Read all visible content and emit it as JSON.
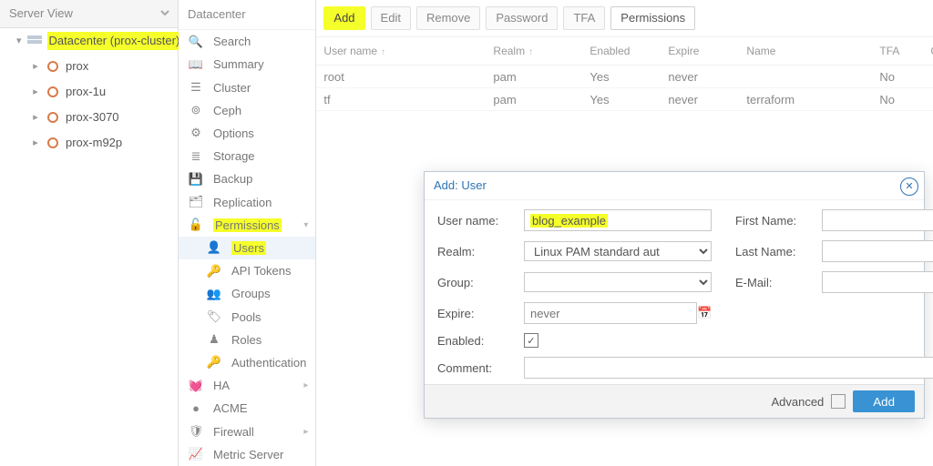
{
  "tree": {
    "header": "Server View",
    "root": "Datacenter (prox-cluster)",
    "nodes": [
      "prox",
      "prox-1u",
      "prox-3070",
      "prox-m92p"
    ]
  },
  "breadcrumb": "Datacenter",
  "menu": {
    "search": "Search",
    "summary": "Summary",
    "cluster": "Cluster",
    "ceph": "Ceph",
    "options": "Options",
    "storage": "Storage",
    "backup": "Backup",
    "replication": "Replication",
    "permissions": "Permissions",
    "users": "Users",
    "apitokens": "API Tokens",
    "groups": "Groups",
    "pools": "Pools",
    "roles": "Roles",
    "auth": "Authentication",
    "ha": "HA",
    "acme": "ACME",
    "firewall": "Firewall",
    "metric": "Metric Server"
  },
  "toolbar": {
    "add": "Add",
    "edit": "Edit",
    "remove": "Remove",
    "password": "Password",
    "tfa": "TFA",
    "permissions": "Permissions"
  },
  "grid": {
    "headers": {
      "user": "User name",
      "realm": "Realm",
      "enabled": "Enabled",
      "expire": "Expire",
      "name": "Name",
      "tfa": "TFA",
      "comment": "Comment"
    },
    "rows": [
      {
        "user": "root",
        "realm": "pam",
        "enabled": "Yes",
        "expire": "never",
        "name": "",
        "tfa": "No",
        "comment": ""
      },
      {
        "user": "tf",
        "realm": "pam",
        "enabled": "Yes",
        "expire": "never",
        "name": "terraform",
        "tfa": "No",
        "comment": ""
      }
    ]
  },
  "modal": {
    "title": "Add: User",
    "labels": {
      "user": "User name:",
      "realm": "Realm:",
      "group": "Group:",
      "expire": "Expire:",
      "enabled": "Enabled:",
      "first": "First Name:",
      "last": "Last Name:",
      "email": "E-Mail:",
      "comment": "Comment:"
    },
    "values": {
      "user": "blog_example",
      "realm": "Linux PAM standard aut",
      "expire": "never"
    },
    "footer": {
      "advanced": "Advanced",
      "add": "Add"
    }
  }
}
